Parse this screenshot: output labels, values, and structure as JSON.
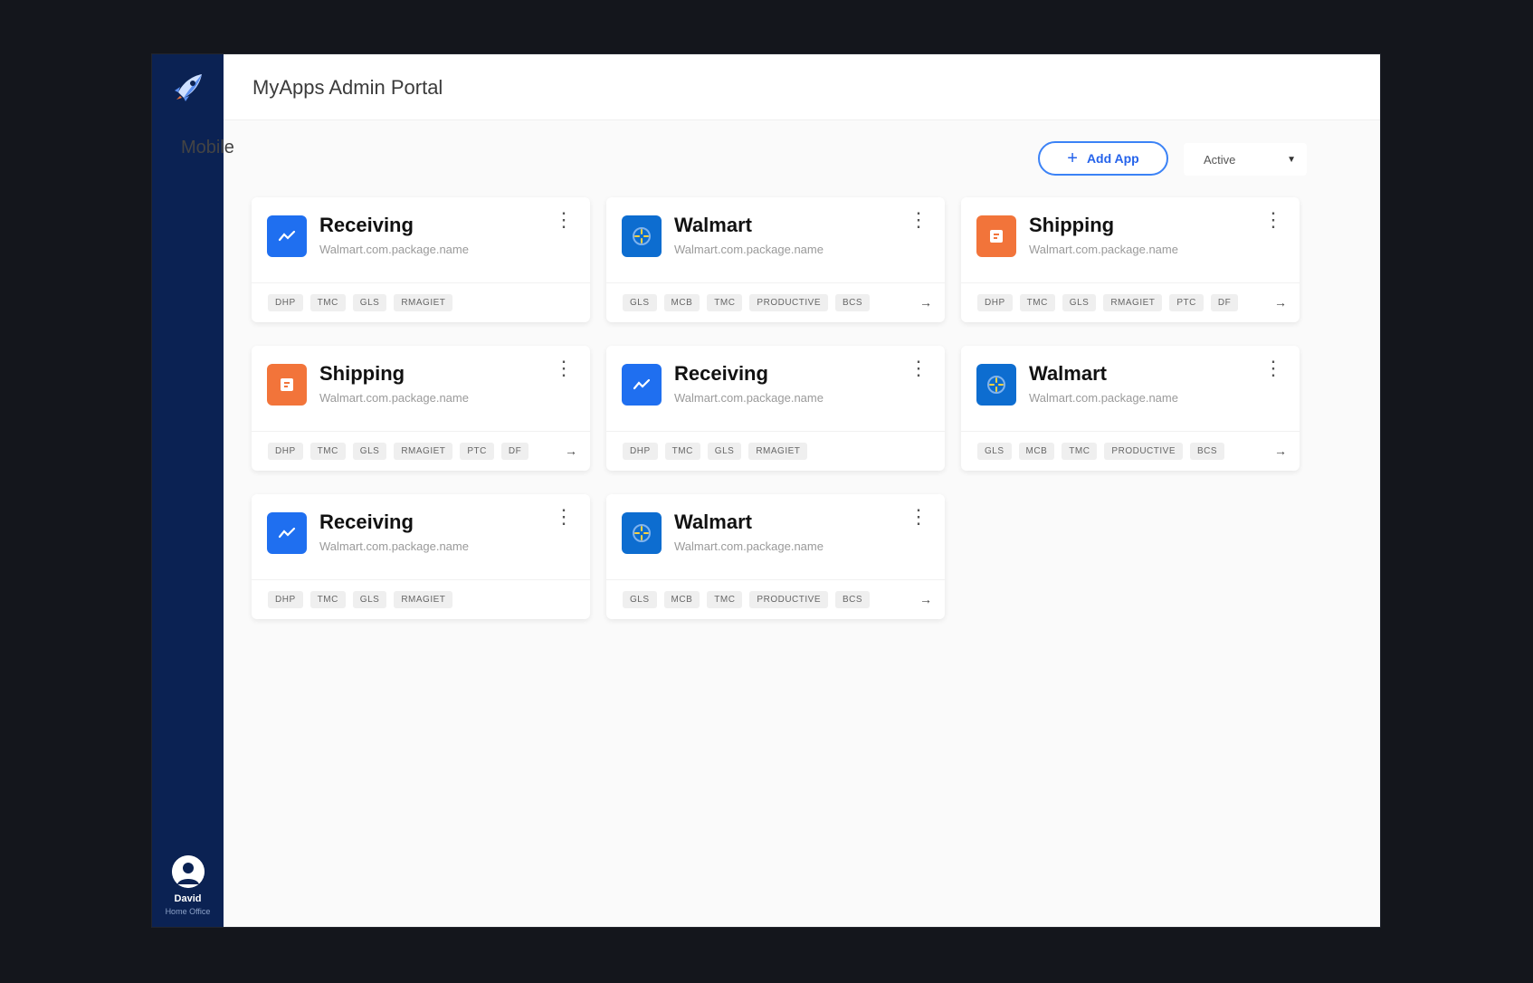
{
  "header": {
    "title": "MyApps Admin Portal"
  },
  "main": {
    "section_title": "Mobile",
    "add_app_label": "Add App",
    "status_filter": "Active"
  },
  "user": {
    "name": "David",
    "role": "Home Office"
  },
  "colors": {
    "receiving": "#1f6ff0",
    "walmart": "#0d6dd0",
    "shipping": "#f2743a",
    "sidebar": "#0b2253"
  },
  "cards": [
    {
      "name": "Receiving",
      "subtitle": "Walmart.com.package.name",
      "icon": "receiving-icon",
      "tags": [
        "DHP",
        "TMC",
        "GLS",
        "RMAGIET"
      ],
      "more": false
    },
    {
      "name": "Walmart",
      "subtitle": "Walmart.com.package.name",
      "icon": "walmart-spark-icon",
      "tags": [
        "GLS",
        "MCB",
        "TMC",
        "PRODUCTIVE",
        "BCS"
      ],
      "more": true
    },
    {
      "name": "Shipping",
      "subtitle": "Walmart.com.package.name",
      "icon": "shipping-icon",
      "tags": [
        "DHP",
        "TMC",
        "GLS",
        "RMAGIET",
        "PTC",
        "DF"
      ],
      "more": true
    },
    {
      "name": "Shipping",
      "subtitle": "Walmart.com.package.name",
      "icon": "shipping-icon",
      "tags": [
        "DHP",
        "TMC",
        "GLS",
        "RMAGIET",
        "PTC",
        "DF"
      ],
      "more": true
    },
    {
      "name": "Receiving",
      "subtitle": "Walmart.com.package.name",
      "icon": "receiving-icon",
      "tags": [
        "DHP",
        "TMC",
        "GLS",
        "RMAGIET"
      ],
      "more": false
    },
    {
      "name": "Walmart",
      "subtitle": "Walmart.com.package.name",
      "icon": "walmart-spark-icon",
      "tags": [
        "GLS",
        "MCB",
        "TMC",
        "PRODUCTIVE",
        "BCS"
      ],
      "more": true
    },
    {
      "name": "Receiving",
      "subtitle": "Walmart.com.package.name",
      "icon": "receiving-icon",
      "tags": [
        "DHP",
        "TMC",
        "GLS",
        "RMAGIET"
      ],
      "more": false
    },
    {
      "name": "Walmart",
      "subtitle": "Walmart.com.package.name",
      "icon": "walmart-spark-icon",
      "tags": [
        "GLS",
        "MCB",
        "TMC",
        "PRODUCTIVE",
        "BCS"
      ],
      "more": true
    }
  ]
}
